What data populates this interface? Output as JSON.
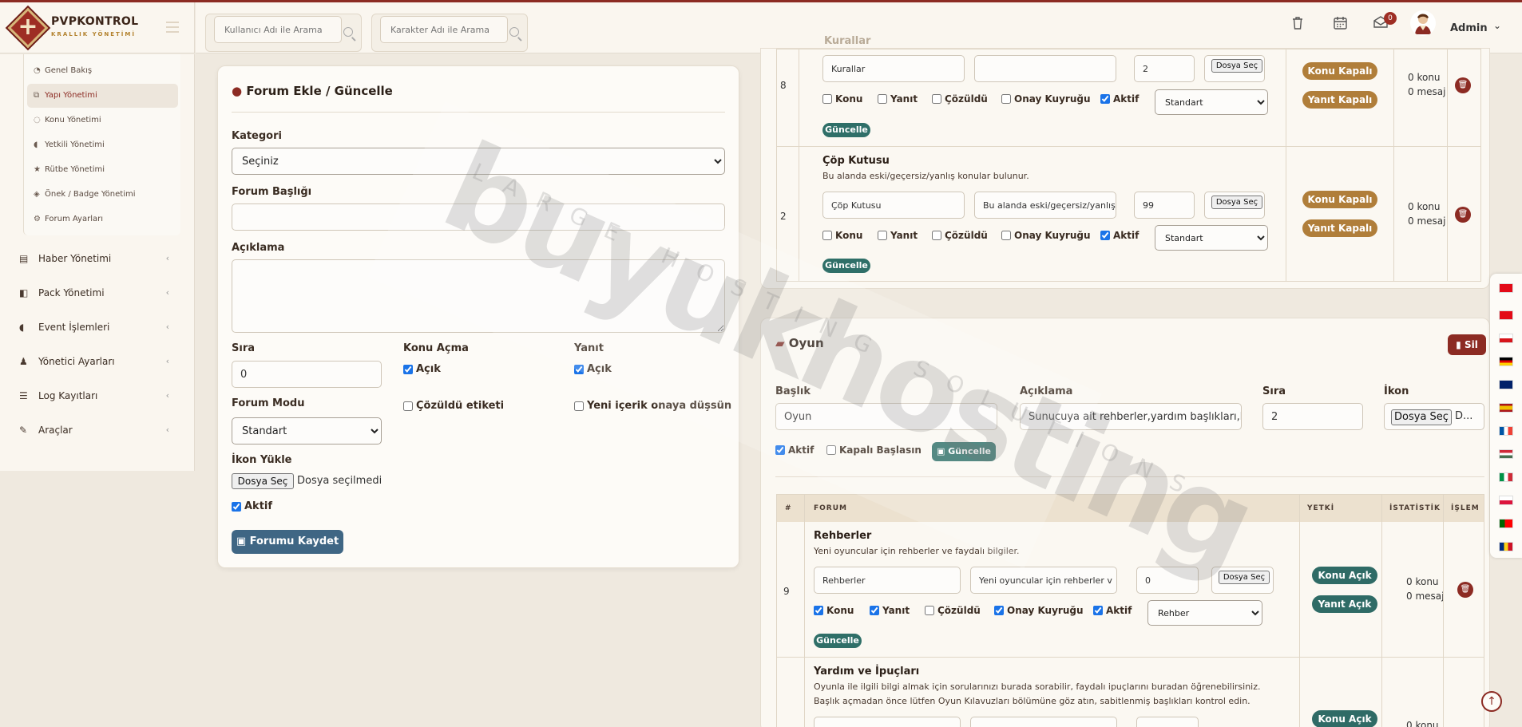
{
  "brand": {
    "name": "PVPKONTROL",
    "subtitle": "KRALLIK YÖNETİMİ"
  },
  "header": {
    "user_search_placeholder": "Kullanıcı Adı ile Arama",
    "char_search_placeholder": "Karakter Adı ile Arama",
    "notification_count": "0",
    "admin_name": "Admin"
  },
  "sidebar": {
    "subitems": [
      {
        "label": "Genel Bakış",
        "icon": "gauge-icon"
      },
      {
        "label": "Yapı Yönetimi",
        "icon": "sitemap-icon",
        "active": true
      },
      {
        "label": "Konu Yönetimi",
        "icon": "comments-icon"
      },
      {
        "label": "Yetkili Yönetimi",
        "icon": "shield-icon"
      },
      {
        "label": "Rütbe Yönetimi",
        "icon": "star-icon"
      },
      {
        "label": "Önek / Badge Yönetimi",
        "icon": "tags-icon"
      },
      {
        "label": "Forum Ayarları",
        "icon": "cogs-icon"
      }
    ],
    "nav": [
      {
        "label": "Haber Yönetimi",
        "icon": "newspaper-icon"
      },
      {
        "label": "Pack Yönetimi",
        "icon": "box-icon"
      },
      {
        "label": "Event İşlemleri",
        "icon": "shield-icon"
      },
      {
        "label": "Yönetici Ayarları",
        "icon": "user-tie-icon"
      },
      {
        "label": "Log Kayıtları",
        "icon": "list-icon"
      },
      {
        "label": "Araçlar",
        "icon": "wrench-icon"
      }
    ]
  },
  "form": {
    "title": "Forum Ekle / Güncelle",
    "category_label": "Kategori",
    "category_value": "Seçiniz",
    "title_label": "Forum Başlığı",
    "title_value": "",
    "desc_label": "Açıklama",
    "order_label": "Sıra",
    "order_value": "0",
    "topic_open_label": "Konu Açma",
    "topic_open_check": "Açık",
    "reply_label": "Yanıt",
    "reply_check": "Açık",
    "mode_label": "Forum Modu",
    "mode_value": "Standart",
    "solved_label": "Çözüldü etiketi",
    "approval_label": "Yeni içerik onaya düşsün",
    "icon_label": "İkon Yükle",
    "file_button": "Dosya Seç",
    "file_none": "Dosya seçilmedi",
    "active_label": "Aktif",
    "save_button": "Forumu Kaydet"
  },
  "common": {
    "chk_konu": "Konu",
    "chk_yanit": "Yanıt",
    "chk_cozuldu": "Çözüldü",
    "chk_onay": "Onay Kuyruğu",
    "chk_aktif": "Aktif",
    "update_button": "Güncelle",
    "file_button_small": "Dosya Seç"
  },
  "top_rows": [
    {
      "num": "8",
      "name": "",
      "name_input": "Kurallar",
      "desc_input": "",
      "order": "2",
      "mode": "Standart",
      "btn1": "Konu Kapalı",
      "btn2": "Yanıt Kapalı",
      "topics": "0 konu",
      "messages": "0 mesaj",
      "header_label": "Kurallar"
    },
    {
      "num": "2",
      "name": "Çöp Kutusu",
      "desc": "Bu alanda eski/geçersiz/yanlış konular bulunur.",
      "name_input": "Çöp Kutusu",
      "desc_input": "Bu alanda eski/geçersiz/yanlış k",
      "order": "99",
      "mode": "Standart",
      "btn1": "Konu Kapalı",
      "btn2": "Yanıt Kapalı",
      "topics": "0 konu",
      "messages": "0 mesaj"
    }
  ],
  "category": {
    "title": "Oyun",
    "delete_button": "Sil",
    "title_label": "Başlık",
    "title_value": "Oyun",
    "desc_label": "Açıklama",
    "desc_value": "Sunucuya ait rehberler,yardım başlıkları,kla",
    "order_label": "Sıra",
    "order_value": "2",
    "icon_label": "İkon",
    "file_button": "Dosya Seç",
    "file_text": "D...",
    "active_label": "Aktif",
    "closed_label": "Kapalı Başlasın",
    "update_button": "Güncelle",
    "table_headers": {
      "num": "#",
      "forum": "FORUM",
      "perm": "YETKİ",
      "stats": "İSTATİSTİK",
      "action": "İŞLEM"
    }
  },
  "cat_rows": [
    {
      "num": "9",
      "name": "Rehberler",
      "desc": "Yeni oyuncular için rehberler ve faydalı bilgiler.",
      "name_input": "Rehberler",
      "desc_input": "Yeni oyuncular için rehberler v",
      "order": "0",
      "mode": "Rehber",
      "btn1": "Konu Açık",
      "btn2": "Yanıt Açık",
      "topics": "0 konu",
      "messages": "0 mesaj"
    },
    {
      "name": "Yardım ve İpuçları",
      "desc": "Oyunla ile ilgili bilgi almak için sorularınızı burada sorabilir, faydalı ipuçlarını buradan öğrenebilirsiniz. Başlık açmadan önce lütfen Oyun Kılavuzları bölümüne göz atın, sabitlenmiş başlıkları kontrol edin.",
      "btn1": "Konu Açık",
      "topics": "0 konu"
    }
  ],
  "watermark": {
    "main": "buyukhosting",
    "sub": "LARGE HOSTING SOLUTIONS"
  },
  "colors": {
    "primary": "#8c2b23",
    "accent_gold": "#b07e3a",
    "teal": "#2f6f68",
    "save_blue": "#3f6684"
  }
}
